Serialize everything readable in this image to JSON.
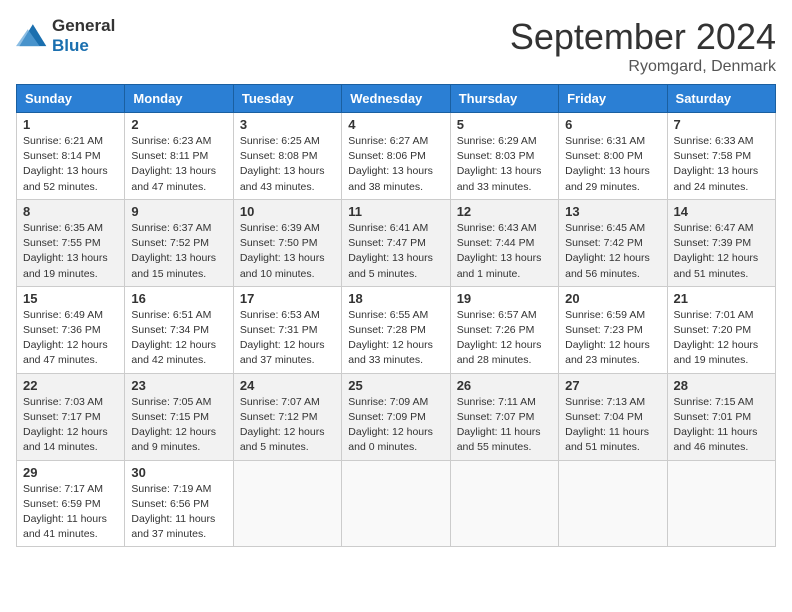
{
  "header": {
    "logo": {
      "general": "General",
      "blue": "Blue"
    },
    "title": "September 2024",
    "location": "Ryomgard, Denmark"
  },
  "weekdays": [
    "Sunday",
    "Monday",
    "Tuesday",
    "Wednesday",
    "Thursday",
    "Friday",
    "Saturday"
  ],
  "weeks": [
    [
      {
        "day": "1",
        "info": "Sunrise: 6:21 AM\nSunset: 8:14 PM\nDaylight: 13 hours\nand 52 minutes."
      },
      {
        "day": "2",
        "info": "Sunrise: 6:23 AM\nSunset: 8:11 PM\nDaylight: 13 hours\nand 47 minutes."
      },
      {
        "day": "3",
        "info": "Sunrise: 6:25 AM\nSunset: 8:08 PM\nDaylight: 13 hours\nand 43 minutes."
      },
      {
        "day": "4",
        "info": "Sunrise: 6:27 AM\nSunset: 8:06 PM\nDaylight: 13 hours\nand 38 minutes."
      },
      {
        "day": "5",
        "info": "Sunrise: 6:29 AM\nSunset: 8:03 PM\nDaylight: 13 hours\nand 33 minutes."
      },
      {
        "day": "6",
        "info": "Sunrise: 6:31 AM\nSunset: 8:00 PM\nDaylight: 13 hours\nand 29 minutes."
      },
      {
        "day": "7",
        "info": "Sunrise: 6:33 AM\nSunset: 7:58 PM\nDaylight: 13 hours\nand 24 minutes."
      }
    ],
    [
      {
        "day": "8",
        "info": "Sunrise: 6:35 AM\nSunset: 7:55 PM\nDaylight: 13 hours\nand 19 minutes."
      },
      {
        "day": "9",
        "info": "Sunrise: 6:37 AM\nSunset: 7:52 PM\nDaylight: 13 hours\nand 15 minutes."
      },
      {
        "day": "10",
        "info": "Sunrise: 6:39 AM\nSunset: 7:50 PM\nDaylight: 13 hours\nand 10 minutes."
      },
      {
        "day": "11",
        "info": "Sunrise: 6:41 AM\nSunset: 7:47 PM\nDaylight: 13 hours\nand 5 minutes."
      },
      {
        "day": "12",
        "info": "Sunrise: 6:43 AM\nSunset: 7:44 PM\nDaylight: 13 hours\nand 1 minute."
      },
      {
        "day": "13",
        "info": "Sunrise: 6:45 AM\nSunset: 7:42 PM\nDaylight: 12 hours\nand 56 minutes."
      },
      {
        "day": "14",
        "info": "Sunrise: 6:47 AM\nSunset: 7:39 PM\nDaylight: 12 hours\nand 51 minutes."
      }
    ],
    [
      {
        "day": "15",
        "info": "Sunrise: 6:49 AM\nSunset: 7:36 PM\nDaylight: 12 hours\nand 47 minutes."
      },
      {
        "day": "16",
        "info": "Sunrise: 6:51 AM\nSunset: 7:34 PM\nDaylight: 12 hours\nand 42 minutes."
      },
      {
        "day": "17",
        "info": "Sunrise: 6:53 AM\nSunset: 7:31 PM\nDaylight: 12 hours\nand 37 minutes."
      },
      {
        "day": "18",
        "info": "Sunrise: 6:55 AM\nSunset: 7:28 PM\nDaylight: 12 hours\nand 33 minutes."
      },
      {
        "day": "19",
        "info": "Sunrise: 6:57 AM\nSunset: 7:26 PM\nDaylight: 12 hours\nand 28 minutes."
      },
      {
        "day": "20",
        "info": "Sunrise: 6:59 AM\nSunset: 7:23 PM\nDaylight: 12 hours\nand 23 minutes."
      },
      {
        "day": "21",
        "info": "Sunrise: 7:01 AM\nSunset: 7:20 PM\nDaylight: 12 hours\nand 19 minutes."
      }
    ],
    [
      {
        "day": "22",
        "info": "Sunrise: 7:03 AM\nSunset: 7:17 PM\nDaylight: 12 hours\nand 14 minutes."
      },
      {
        "day": "23",
        "info": "Sunrise: 7:05 AM\nSunset: 7:15 PM\nDaylight: 12 hours\nand 9 minutes."
      },
      {
        "day": "24",
        "info": "Sunrise: 7:07 AM\nSunset: 7:12 PM\nDaylight: 12 hours\nand 5 minutes."
      },
      {
        "day": "25",
        "info": "Sunrise: 7:09 AM\nSunset: 7:09 PM\nDaylight: 12 hours\nand 0 minutes."
      },
      {
        "day": "26",
        "info": "Sunrise: 7:11 AM\nSunset: 7:07 PM\nDaylight: 11 hours\nand 55 minutes."
      },
      {
        "day": "27",
        "info": "Sunrise: 7:13 AM\nSunset: 7:04 PM\nDaylight: 11 hours\nand 51 minutes."
      },
      {
        "day": "28",
        "info": "Sunrise: 7:15 AM\nSunset: 7:01 PM\nDaylight: 11 hours\nand 46 minutes."
      }
    ],
    [
      {
        "day": "29",
        "info": "Sunrise: 7:17 AM\nSunset: 6:59 PM\nDaylight: 11 hours\nand 41 minutes."
      },
      {
        "day": "30",
        "info": "Sunrise: 7:19 AM\nSunset: 6:56 PM\nDaylight: 11 hours\nand 37 minutes."
      },
      {
        "day": "",
        "info": ""
      },
      {
        "day": "",
        "info": ""
      },
      {
        "day": "",
        "info": ""
      },
      {
        "day": "",
        "info": ""
      },
      {
        "day": "",
        "info": ""
      }
    ]
  ]
}
